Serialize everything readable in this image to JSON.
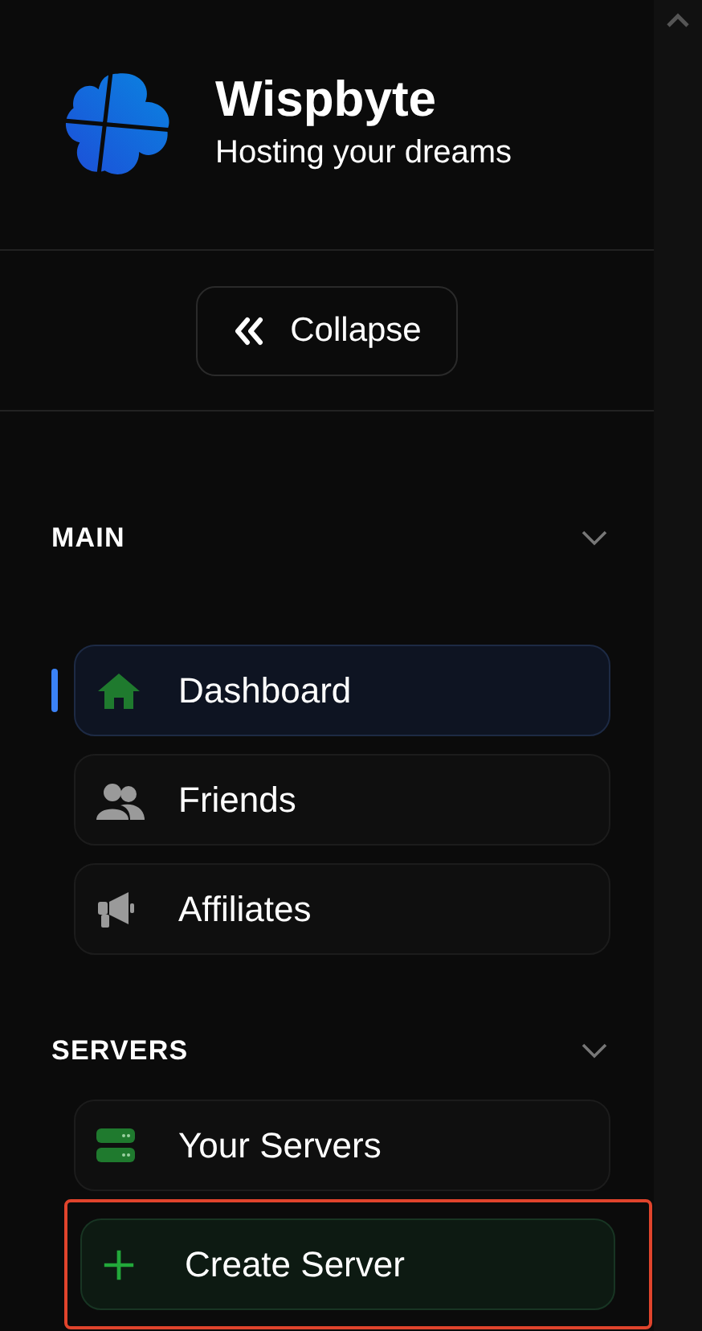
{
  "brand": {
    "title": "Wispbyte",
    "tagline": "Hosting your dreams"
  },
  "collapse_button": {
    "label": "Collapse"
  },
  "sections": [
    {
      "title": "MAIN",
      "expanded": true,
      "items": [
        {
          "label": "Dashboard",
          "kind": "home",
          "selected": true,
          "highlighted": false
        },
        {
          "label": "Friends",
          "kind": "people",
          "selected": false,
          "highlighted": false
        },
        {
          "label": "Affiliates",
          "kind": "megaphone",
          "selected": false,
          "highlighted": false
        }
      ]
    },
    {
      "title": "SERVERS",
      "expanded": true,
      "items": [
        {
          "label": "Your Servers",
          "kind": "servers",
          "selected": false,
          "highlighted": false
        },
        {
          "label": "Create Server",
          "kind": "create",
          "selected": false,
          "highlighted": true
        }
      ]
    }
  ]
}
